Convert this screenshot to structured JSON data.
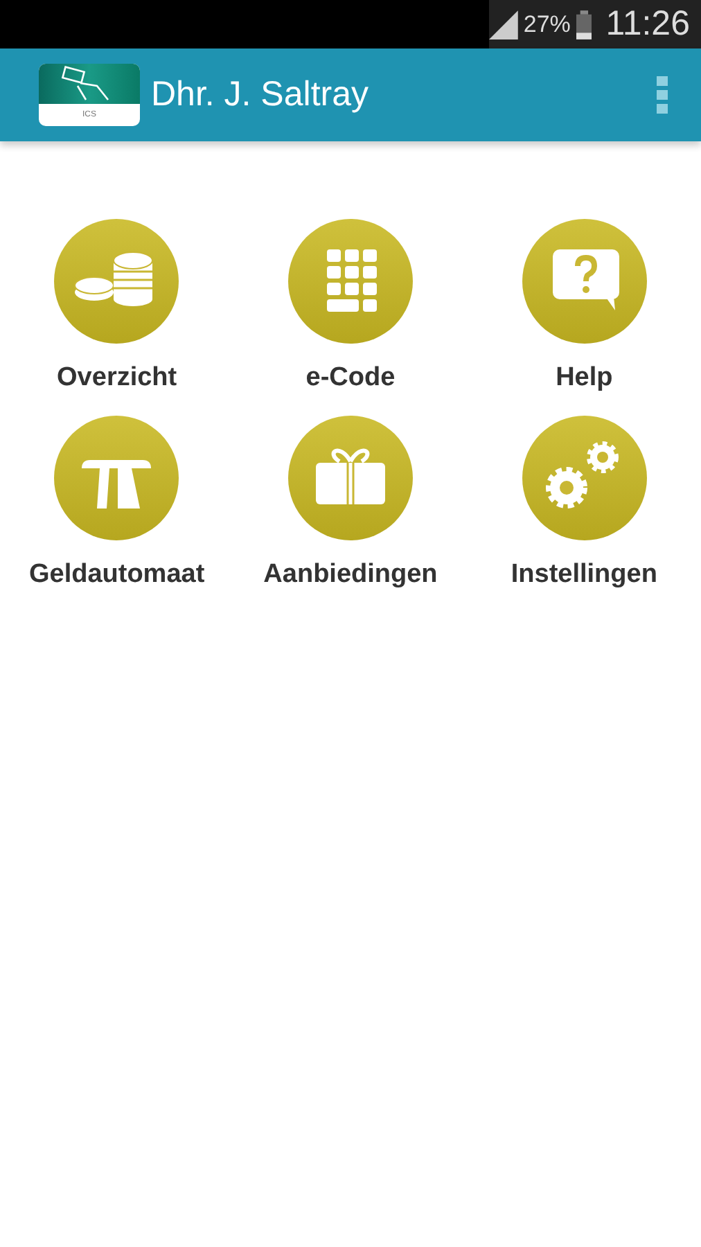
{
  "status_bar": {
    "battery": "27%",
    "time": "11:26"
  },
  "app_bar": {
    "logo_text": "ICS",
    "title": "Dhr. J. Saltray"
  },
  "tiles": [
    {
      "kind": "coins",
      "label": "Overzicht"
    },
    {
      "kind": "keypad",
      "label": "e-Code"
    },
    {
      "kind": "help",
      "label": "Help"
    },
    {
      "kind": "atm",
      "label": "Geldautomaat"
    },
    {
      "kind": "gift",
      "label": "Aanbiedingen"
    },
    {
      "kind": "gears",
      "label": "Instellingen"
    }
  ]
}
